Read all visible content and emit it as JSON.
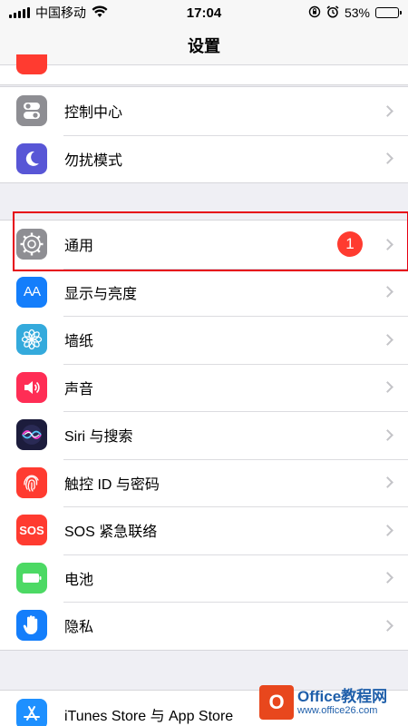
{
  "status_bar": {
    "carrier": "中国移动",
    "time": "17:04",
    "battery_percent": "53%",
    "battery_level": 0.53,
    "icons": [
      "signal-icon",
      "wifi-icon",
      "orientation-lock-icon",
      "alarm-icon",
      "battery-icon"
    ]
  },
  "nav": {
    "title": "设置"
  },
  "groups": [
    {
      "items": [
        {
          "label": "控制中心",
          "icon": "control-center-icon",
          "icon_color": "#8e8e93"
        },
        {
          "label": "勿扰模式",
          "icon": "moon-icon",
          "icon_color": "#5856d6"
        }
      ]
    },
    {
      "items": [
        {
          "label": "通用",
          "icon": "gear-icon",
          "icon_color": "#8e8e93",
          "badge": "1",
          "highlighted": true
        },
        {
          "label": "显示与亮度",
          "icon": "display-brightness-icon",
          "icon_color": "#147efb",
          "icon_text": "AA"
        },
        {
          "label": "墙纸",
          "icon": "flower-icon",
          "icon_color": "#34aadc"
        },
        {
          "label": "声音",
          "icon": "speaker-icon",
          "icon_color": "#ff2d55"
        },
        {
          "label": "Siri 与搜索",
          "icon": "siri-icon",
          "icon_color": "#1c1c3c"
        },
        {
          "label": "触控 ID 与密码",
          "icon": "fingerprint-icon",
          "icon_color": "#ff3b30"
        },
        {
          "label": "SOS 紧急联络",
          "icon": "sos-icon",
          "icon_color": "#ff3b30",
          "icon_text": "SOS"
        },
        {
          "label": "电池",
          "icon": "battery-app-icon",
          "icon_color": "#4cd964"
        },
        {
          "label": "隐私",
          "icon": "hand-icon",
          "icon_color": "#147efb"
        }
      ]
    },
    {
      "items": [
        {
          "label": "iTunes Store 与 App Store",
          "icon": "app-store-icon",
          "icon_color": "#1e90ff"
        }
      ]
    }
  ],
  "colors": {
    "badge": "#ff3b30",
    "highlight_border": "#e60012",
    "chevron": "#c4c4c8",
    "background": "#efeff4"
  },
  "watermark": {
    "logo_text": "O",
    "title": "Office教程网",
    "url": "www.office26.com"
  }
}
